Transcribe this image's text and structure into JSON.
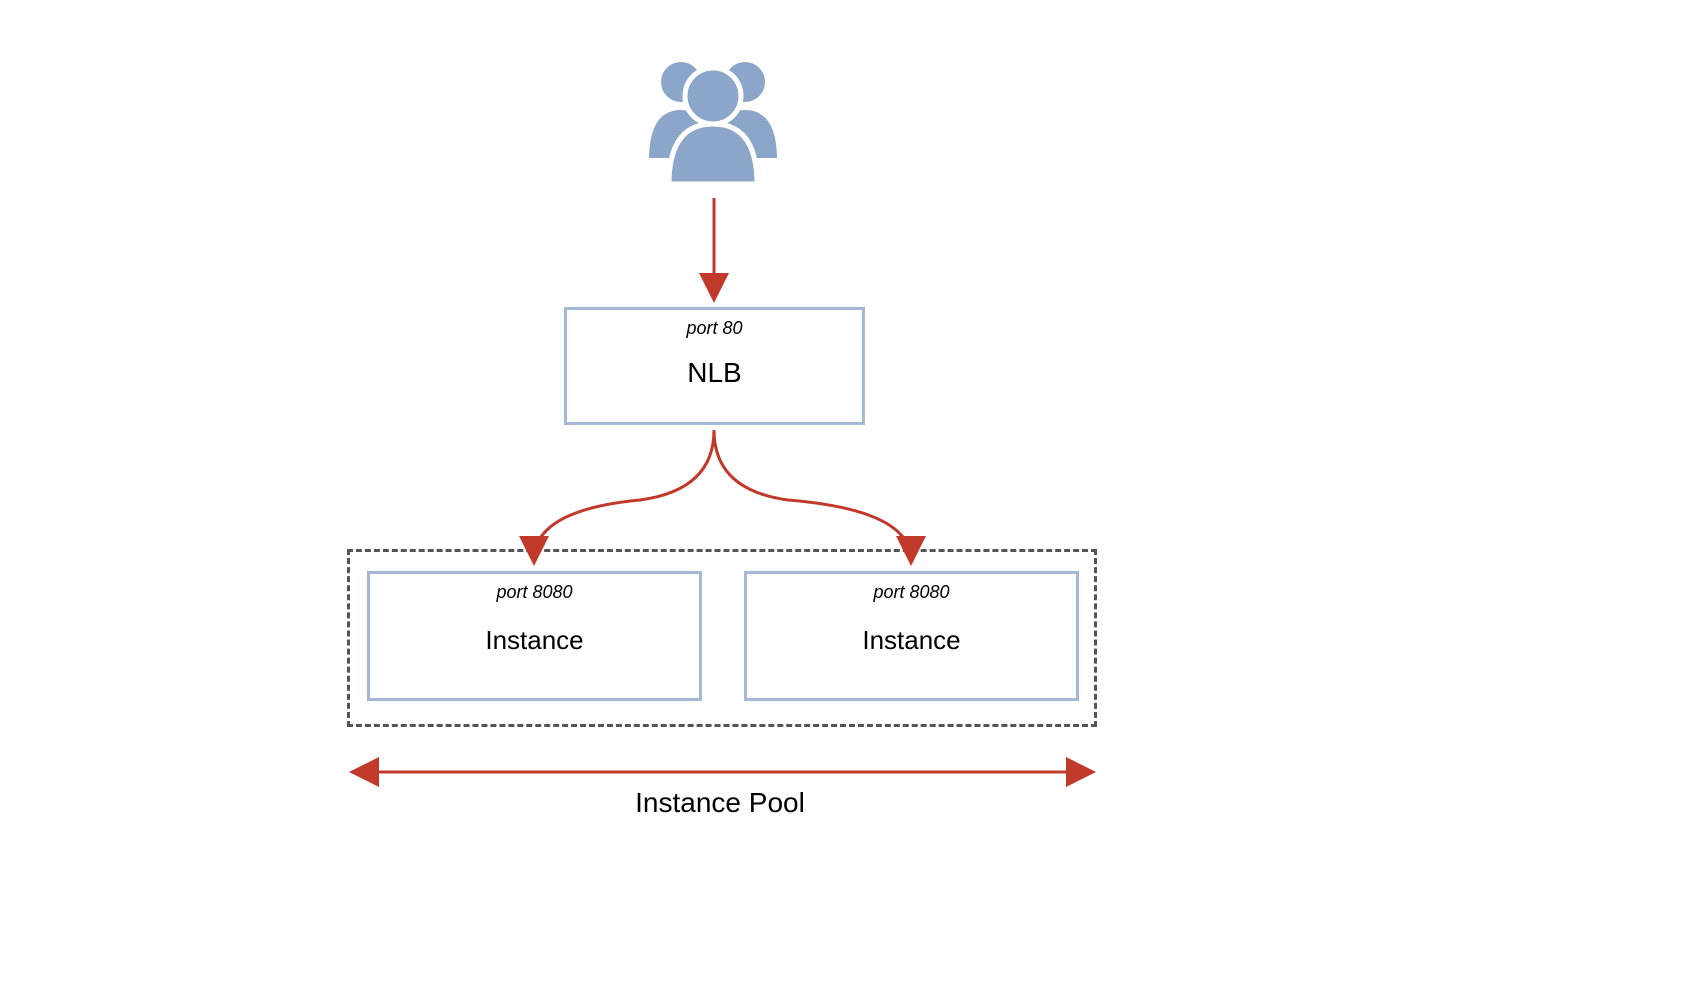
{
  "diagram": {
    "nlb": {
      "port_label": "port 80",
      "title": "NLB"
    },
    "instance1": {
      "port_label": "port 8080",
      "title": "Instance"
    },
    "instance2": {
      "port_label": "port 8080",
      "title": "Instance"
    },
    "pool_label": "Instance Pool",
    "colors": {
      "arrow": "#c0392b",
      "box_border": "#a4b9d7",
      "users_fill": "#8ca6c9",
      "dash_border": "#555555"
    }
  }
}
